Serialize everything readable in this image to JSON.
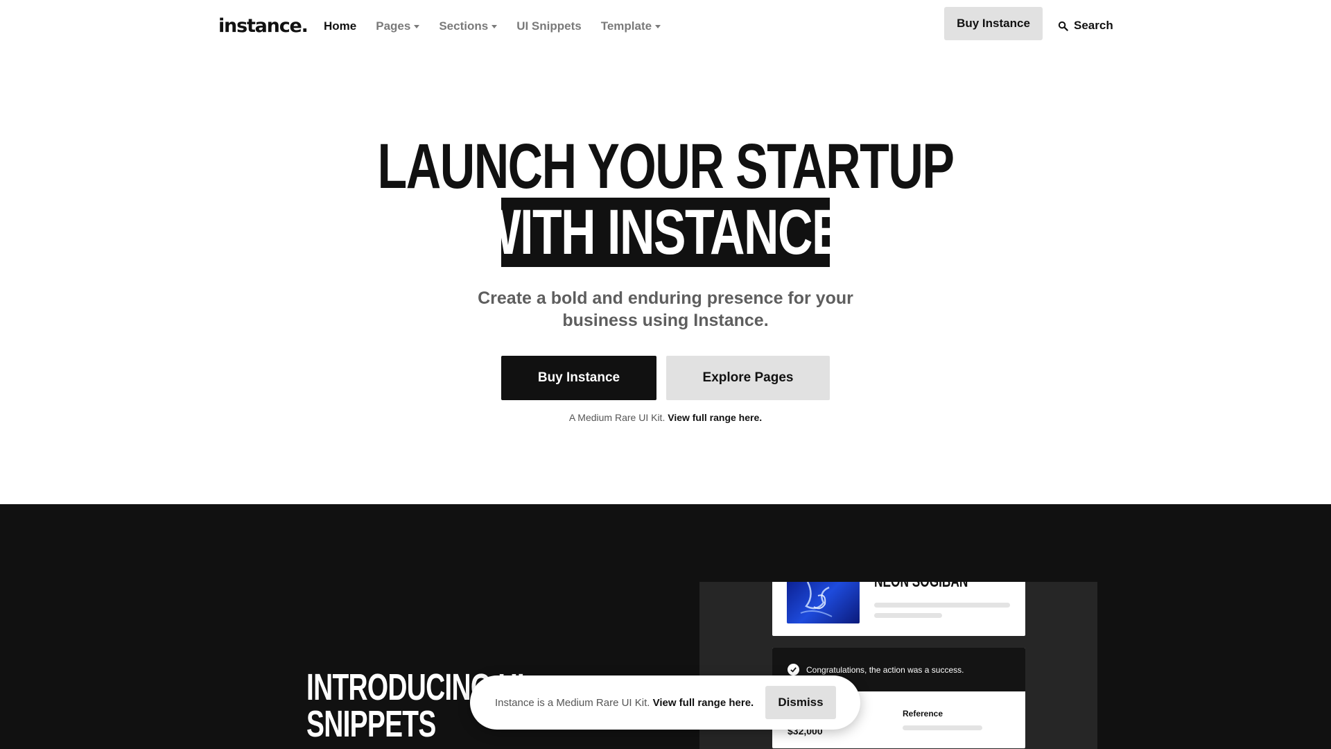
{
  "nav": {
    "logo": "instance.",
    "links": [
      {
        "label": "Home"
      },
      {
        "label": "Pages"
      },
      {
        "label": "Sections"
      },
      {
        "label": "UI Snippets"
      },
      {
        "label": "Template"
      }
    ],
    "buy_label": "Buy Instance",
    "search_label": "Search",
    "search_icon": "search-icon"
  },
  "hero": {
    "line1": "LAUNCH YOUR STARTUP",
    "line2": "WITH INSTANCE.",
    "subtitle": "Create a bold and enduring presence for your business using Instance.",
    "primary_cta": "Buy Instance",
    "secondary_cta": "Explore Pages",
    "note_prefix": "A Medium Rare UI Kit.",
    "note_link": "View full range here."
  },
  "snippets": {
    "title_line1": "INTRODUCING UI",
    "title_line2": "SNIPPETS",
    "card_title": "NEON SOGIBAN",
    "alert_text": "Congratulations, the action was a success.",
    "reference_label": "Reference",
    "amount": "$32,000",
    "check_icon": "check-circle-icon"
  },
  "toast": {
    "text_prefix": "Instance is a Medium Rare UI Kit.",
    "text_link": "View full range here.",
    "dismiss_label": "Dismiss"
  },
  "colors": {
    "dark": "#111111",
    "panel": "#262626",
    "light_button": "#e1e1e1",
    "muted_text": "#7a7a7a"
  }
}
